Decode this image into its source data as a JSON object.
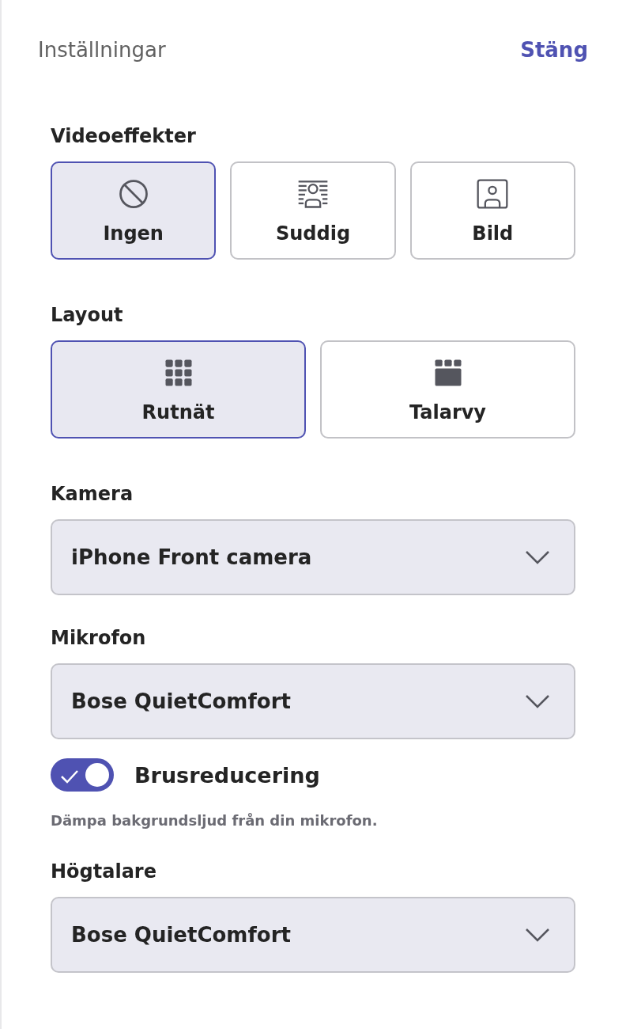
{
  "header": {
    "title": "Inställningar",
    "close": "Stäng"
  },
  "video_effects": {
    "label": "Videoeffekter",
    "options": [
      {
        "kind": "none",
        "label": "Ingen",
        "selected": true
      },
      {
        "kind": "blur",
        "label": "Suddig",
        "selected": false
      },
      {
        "kind": "image",
        "label": "Bild",
        "selected": false
      }
    ]
  },
  "layout": {
    "label": "Layout",
    "options": [
      {
        "kind": "grid",
        "label": "Rutnät",
        "selected": true
      },
      {
        "kind": "speaker",
        "label": "Talarvy",
        "selected": false
      }
    ]
  },
  "camera": {
    "label": "Kamera",
    "value": "iPhone Front camera"
  },
  "microphone": {
    "label": "Mikrofon",
    "value": "Bose QuietComfort"
  },
  "noise_reduction": {
    "label": "Brusreducering",
    "on": true,
    "description": "Dämpa bakgrundsljud från din mikrofon."
  },
  "speaker": {
    "label": "Högtalare",
    "value": "Bose QuietComfort"
  }
}
